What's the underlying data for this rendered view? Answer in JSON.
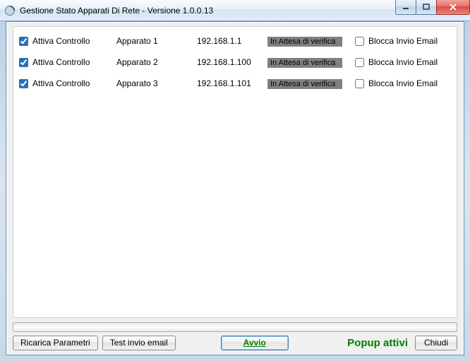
{
  "window": {
    "title": "Gestione Stato Apparati Di Rete - Versione 1.0.0.13"
  },
  "labels": {
    "attiva_controllo": "Attiva Controllo",
    "blocca_invio_email": "Blocca Invio Email"
  },
  "rows": [
    {
      "name": "Apparato 1",
      "ip": "192.168.1.1",
      "status": "In Attesa di verifica",
      "attiva": true,
      "blocca": false
    },
    {
      "name": "Apparato 2",
      "ip": "192.168.1.100",
      "status": "In Attesa di verifica",
      "attiva": true,
      "blocca": false
    },
    {
      "name": "Apparato 3",
      "ip": "192.168.1.101",
      "status": "In Attesa di verifica",
      "attiva": true,
      "blocca": false
    }
  ],
  "buttons": {
    "ricarica": "Ricarica Parametri",
    "test_email": "Test invio email",
    "avvio": "Avvio",
    "chiudi": "Chiudi"
  },
  "popup_label": "Popup attivi"
}
